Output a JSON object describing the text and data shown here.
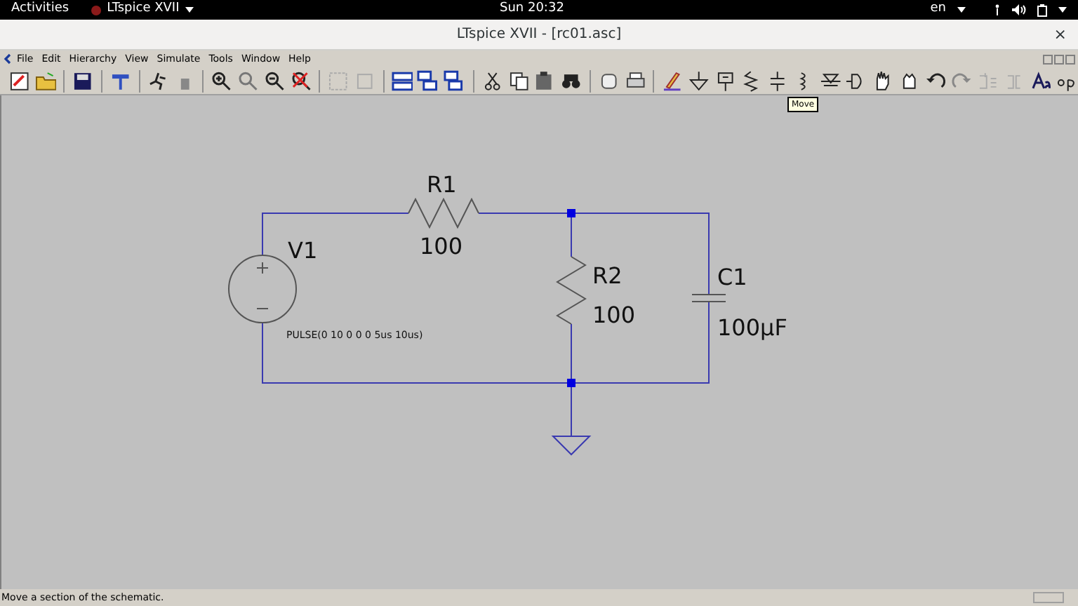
{
  "top_bar": {
    "activities": "Activities",
    "app_menu": "LTspice XVII",
    "clock": "Sun 20:32",
    "language": "en"
  },
  "window": {
    "title": "LTspice XVII - [rc01.asc]",
    "close": "×"
  },
  "menu": [
    "File",
    "Edit",
    "Hierarchy",
    "View",
    "Simulate",
    "Tools",
    "Window",
    "Help"
  ],
  "tooltip": "Move",
  "schematic": {
    "components": [
      {
        "kind": "voltage_source",
        "name": "V1",
        "value": "PULSE(0 10 0 0 0 5us 10us)"
      },
      {
        "kind": "resistor_h",
        "name": "R1",
        "value": "100"
      },
      {
        "kind": "resistor_v",
        "name": "R2",
        "value": "100"
      },
      {
        "kind": "capacitor",
        "name": "C1",
        "value": "100µF"
      }
    ]
  },
  "status_bar": {
    "message": "Move a section of the schematic."
  }
}
